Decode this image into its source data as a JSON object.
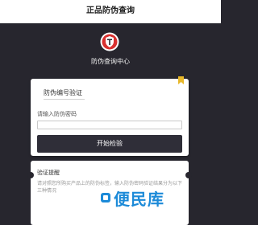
{
  "header": {
    "title": "正品防伪查询"
  },
  "hero": {
    "logo_icon": "brand-shield-logo-icon",
    "title": "防伪查询中心"
  },
  "verify_card": {
    "bookmark_icon": "bookmark-icon",
    "title": "防伪编号验证",
    "prompt_label": "请输入防伪密码",
    "input_value": "",
    "input_placeholder": "",
    "button_label": "开始检验"
  },
  "tips_card": {
    "title": "验证提醒",
    "text": "请对照您所购买产品上的防伪标签，输入防伪密码验证结果分为以下三种情况"
  },
  "watermark": {
    "icon": "watermark-icon",
    "text": "便民库"
  },
  "colors": {
    "background": "#27262e",
    "logo_red": "#d8302f",
    "bookmark": "#e8b82a",
    "button": "#2f2e38",
    "watermark_blue": "#1c8ad8"
  }
}
